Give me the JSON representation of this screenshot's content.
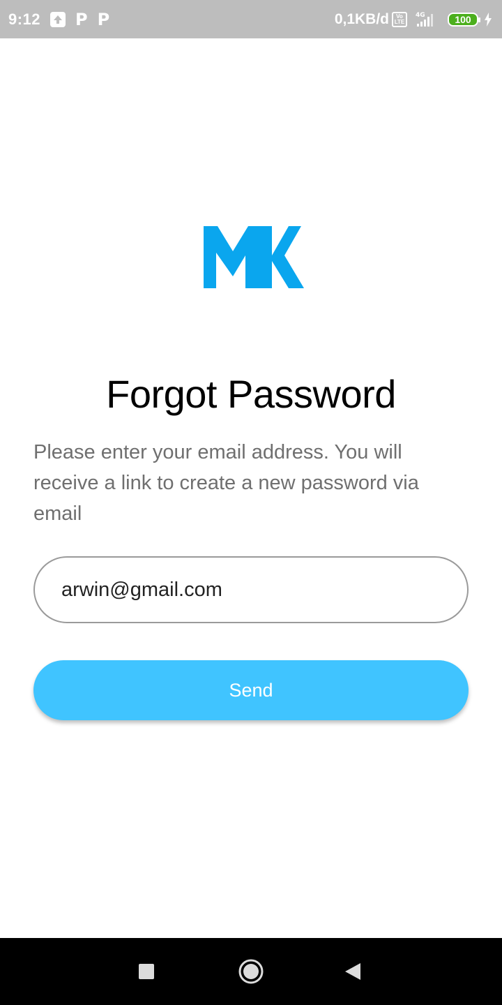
{
  "status_bar": {
    "time": "9:12",
    "p_icon_1": "P",
    "p_icon_2": "P",
    "net_speed": "0,1KB/d",
    "volte_top": "Vo",
    "volte_bottom": "LTE",
    "network_type": "4G",
    "battery_level": "100",
    "icons": [
      "upload-icon",
      "p-icon",
      "p-icon",
      "volte-icon",
      "signal-icon",
      "battery-icon",
      "charge-icon"
    ]
  },
  "logo": {
    "text": "MK",
    "color": "#0aa6ee"
  },
  "main": {
    "title": "Forgot Password",
    "description": "Please enter your email address. You will receive a link to create a new password via email",
    "email_value": "arwin@gmail.com",
    "send_label": "Send"
  },
  "colors": {
    "accent": "#40c4ff",
    "status_bar": "#bdbdbd",
    "nav_bar": "#000000"
  },
  "nav_bar": {
    "buttons": [
      "recent-apps-icon",
      "home-icon",
      "back-icon"
    ]
  }
}
